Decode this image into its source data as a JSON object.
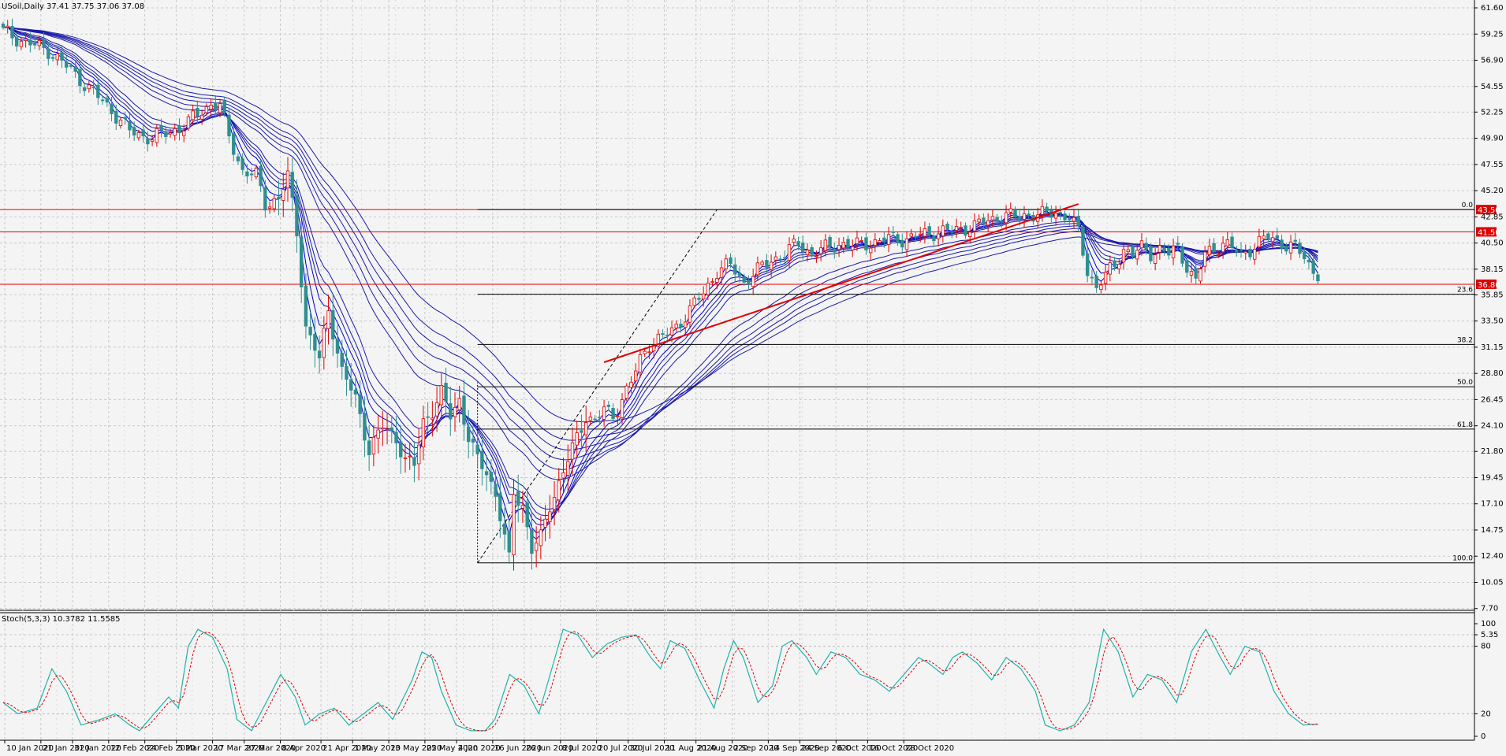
{
  "chart_data": {
    "type": "candlestick",
    "symbol_info": "USoil,Daily  37.41 37.75 37.06 37.08",
    "y_ticks": [
      "61.60",
      "59.25",
      "56.90",
      "54.55",
      "52.25",
      "49.90",
      "47.55",
      "45.20",
      "42.85",
      "40.50",
      "38.15",
      "35.85",
      "33.50",
      "31.15",
      "28.80",
      "26.45",
      "24.10",
      "21.80",
      "19.45",
      "17.10",
      "14.75",
      "12.40",
      "10.05",
      "7.70",
      "5.35"
    ],
    "ylim": [
      5.35,
      61.6
    ],
    "x_ticks": [
      "10 Jan 2020",
      "21 Jan 2020",
      "31 Jan 2020",
      "12 Feb 2020",
      "24 Feb 2020",
      "5 Mar 2020",
      "17 Mar 2020",
      "27 Mar 2020",
      "8 Apr 2020",
      "21 Apr 2020",
      "1 May 2020",
      "13 May 2020",
      "25 May 2020",
      "4 Jun 2020",
      "16 Jun 2020",
      "26 Jun 2020",
      "8 Jul 2020",
      "20 Jul 2020",
      "30 Jul 2020",
      "11 Aug 2020",
      "21 Aug 2020",
      "2 Sep 2020",
      "14 Sep 2020",
      "24 Sep 2020",
      "6 Oct 2020",
      "16 Oct 2020",
      "28 Oct 2020"
    ],
    "horizontal_levels": [
      {
        "value": 43.5,
        "label": "43.50"
      },
      {
        "value": 41.5,
        "label": "41.50"
      },
      {
        "value": 36.8,
        "label": "36.80"
      }
    ],
    "fibonacci": {
      "high": 43.5,
      "low": 11.8,
      "levels": [
        {
          "ratio": "0.0",
          "value": 43.5
        },
        {
          "ratio": "23.6",
          "value": 35.9
        },
        {
          "ratio": "38.2",
          "value": 31.4
        },
        {
          "ratio": "50.0",
          "value": 27.6
        },
        {
          "ratio": "61.8",
          "value": 23.8
        },
        {
          "ratio": "100.0",
          "value": 11.8
        }
      ]
    },
    "close_anchors": [
      [
        0,
        59.5
      ],
      [
        5,
        58.5
      ],
      [
        10,
        57.8
      ],
      [
        15,
        56.0
      ],
      [
        20,
        54.0
      ],
      [
        25,
        52.0
      ],
      [
        28,
        50.5
      ],
      [
        30,
        50.2
      ],
      [
        33,
        50.0
      ],
      [
        36,
        50.3
      ],
      [
        40,
        51.0
      ],
      [
        43,
        52.0
      ],
      [
        46,
        53.0
      ],
      [
        48,
        52.8
      ],
      [
        50,
        50.0
      ],
      [
        53,
        47.0
      ],
      [
        56,
        46.5
      ],
      [
        58,
        44.0
      ],
      [
        61,
        44.5
      ],
      [
        63,
        46.5
      ],
      [
        65,
        41.5
      ],
      [
        67,
        33.0
      ],
      [
        70,
        30.0
      ],
      [
        72,
        34.5
      ],
      [
        75,
        29.0
      ],
      [
        78,
        26.5
      ],
      [
        81,
        22.0
      ],
      [
        84,
        24.0
      ],
      [
        87,
        23.0
      ],
      [
        89,
        21.0
      ],
      [
        91,
        20.5
      ],
      [
        93,
        24.5
      ],
      [
        95,
        25.5
      ],
      [
        97,
        27.0
      ],
      [
        99,
        25.0
      ],
      [
        101,
        26.5
      ],
      [
        103,
        23.0
      ],
      [
        105,
        21.0
      ],
      [
        107,
        20.0
      ],
      [
        109,
        18.0
      ],
      [
        111,
        14.0
      ],
      [
        112,
        12.0
      ],
      [
        113,
        18.0
      ],
      [
        115,
        17.0
      ],
      [
        117,
        13.0
      ],
      [
        119,
        14.0
      ],
      [
        121,
        17.0
      ],
      [
        123,
        19.0
      ],
      [
        125,
        21.0
      ],
      [
        127,
        23.0
      ],
      [
        129,
        25.0
      ],
      [
        131,
        24.5
      ],
      [
        133,
        25.5
      ],
      [
        135,
        25.0
      ],
      [
        137,
        26.5
      ],
      [
        139,
        28.0
      ],
      [
        141,
        30.0
      ],
      [
        143,
        31.5
      ],
      [
        146,
        32.0
      ],
      [
        149,
        33.0
      ],
      [
        152,
        34.5
      ],
      [
        155,
        36.0
      ],
      [
        158,
        38.0
      ],
      [
        161,
        38.5
      ],
      [
        164,
        37.0
      ],
      [
        167,
        38.0
      ],
      [
        170,
        39.0
      ],
      [
        173,
        39.5
      ],
      [
        176,
        40.5
      ],
      [
        179,
        39.5
      ],
      [
        182,
        40.0
      ],
      [
        185,
        40.5
      ],
      [
        188,
        40.2
      ],
      [
        191,
        40.5
      ],
      [
        194,
        40.6
      ],
      [
        197,
        41.0
      ],
      [
        200,
        40.8
      ],
      [
        203,
        41.2
      ],
      [
        206,
        41.5
      ],
      [
        209,
        41.5
      ],
      [
        212,
        41.8
      ],
      [
        215,
        42.0
      ],
      [
        218,
        42.5
      ],
      [
        221,
        43.0
      ],
      [
        224,
        42.8
      ],
      [
        227,
        43.1
      ],
      [
        230,
        43.0
      ],
      [
        233,
        43.3
      ],
      [
        236,
        42.8
      ],
      [
        238,
        41.5
      ],
      [
        240,
        38.0
      ],
      [
        242,
        36.6
      ],
      [
        244,
        37.5
      ],
      [
        246,
        38.5
      ],
      [
        248,
        40.0
      ],
      [
        250,
        39.5
      ],
      [
        252,
        40.0
      ],
      [
        254,
        39.6
      ],
      [
        256,
        40.0
      ],
      [
        258,
        39.5
      ],
      [
        260,
        40.0
      ],
      [
        262,
        38.5
      ],
      [
        264,
        37.0
      ],
      [
        266,
        39.5
      ],
      [
        268,
        40.0
      ],
      [
        270,
        40.5
      ],
      [
        272,
        40.0
      ],
      [
        274,
        39.5
      ],
      [
        276,
        40.0
      ],
      [
        278,
        40.5
      ],
      [
        280,
        41.0
      ],
      [
        282,
        40.8
      ],
      [
        284,
        40.3
      ],
      [
        286,
        40.0
      ],
      [
        288,
        39.3
      ],
      [
        290,
        38.0
      ],
      [
        291,
        37.1
      ]
    ],
    "ema_periods": [
      3,
      5,
      8,
      10,
      12,
      15,
      30,
      35,
      40,
      45,
      50,
      60
    ],
    "trendline": {
      "from": [
        133,
        29.8
      ],
      "to": [
        238,
        44.0
      ]
    },
    "fib_diagonal": {
      "from": [
        105,
        11.8
      ],
      "to": [
        158,
        43.5
      ]
    },
    "stochastic": {
      "label": "Stoch(5,3,3) 10.3782 11.5585",
      "y_ticks": [
        "100",
        "80",
        "20",
        "0"
      ],
      "k_anchors": [
        [
          0,
          30
        ],
        [
          3,
          20
        ],
        [
          7,
          25
        ],
        [
          10,
          60
        ],
        [
          13,
          40
        ],
        [
          16,
          10
        ],
        [
          20,
          15
        ],
        [
          23,
          20
        ],
        [
          26,
          10
        ],
        [
          28,
          5
        ],
        [
          31,
          20
        ],
        [
          34,
          35
        ],
        [
          36,
          25
        ],
        [
          38,
          80
        ],
        [
          40,
          95
        ],
        [
          43,
          88
        ],
        [
          46,
          60
        ],
        [
          48,
          15
        ],
        [
          51,
          5
        ],
        [
          54,
          30
        ],
        [
          57,
          55
        ],
        [
          60,
          35
        ],
        [
          62,
          10
        ],
        [
          65,
          20
        ],
        [
          68,
          25
        ],
        [
          71,
          10
        ],
        [
          74,
          20
        ],
        [
          77,
          30
        ],
        [
          80,
          15
        ],
        [
          84,
          50
        ],
        [
          86,
          75
        ],
        [
          88,
          70
        ],
        [
          90,
          40
        ],
        [
          93,
          10
        ],
        [
          96,
          5
        ],
        [
          99,
          5
        ],
        [
          101,
          15
        ],
        [
          104,
          55
        ],
        [
          107,
          45
        ],
        [
          110,
          20
        ],
        [
          113,
          65
        ],
        [
          115,
          95
        ],
        [
          118,
          90
        ],
        [
          121,
          70
        ],
        [
          124,
          82
        ],
        [
          127,
          88
        ],
        [
          130,
          90
        ],
        [
          133,
          70
        ],
        [
          135,
          60
        ],
        [
          137,
          85
        ],
        [
          140,
          78
        ],
        [
          143,
          50
        ],
        [
          146,
          25
        ],
        [
          148,
          60
        ],
        [
          150,
          85
        ],
        [
          152,
          70
        ],
        [
          155,
          30
        ],
        [
          158,
          45
        ],
        [
          160,
          80
        ],
        [
          162,
          85
        ],
        [
          165,
          70
        ],
        [
          167,
          55
        ],
        [
          170,
          75
        ],
        [
          173,
          70
        ],
        [
          176,
          55
        ],
        [
          179,
          50
        ],
        [
          182,
          40
        ],
        [
          185,
          55
        ],
        [
          188,
          70
        ],
        [
          190,
          65
        ],
        [
          193,
          55
        ],
        [
          195,
          70
        ],
        [
          197,
          75
        ],
        [
          200,
          65
        ],
        [
          203,
          50
        ],
        [
          206,
          70
        ],
        [
          209,
          60
        ],
        [
          212,
          40
        ],
        [
          214,
          10
        ],
        [
          217,
          5
        ],
        [
          220,
          10
        ],
        [
          223,
          30
        ],
        [
          226,
          95
        ],
        [
          229,
          75
        ],
        [
          232,
          35
        ],
        [
          235,
          55
        ],
        [
          238,
          50
        ],
        [
          241,
          30
        ],
        [
          244,
          75
        ],
        [
          247,
          95
        ],
        [
          250,
          70
        ],
        [
          252,
          55
        ],
        [
          255,
          80
        ],
        [
          258,
          75
        ],
        [
          261,
          40
        ],
        [
          264,
          20
        ],
        [
          267,
          10
        ],
        [
          270,
          11
        ]
      ],
      "overbought": 80,
      "oversold": 20
    }
  }
}
